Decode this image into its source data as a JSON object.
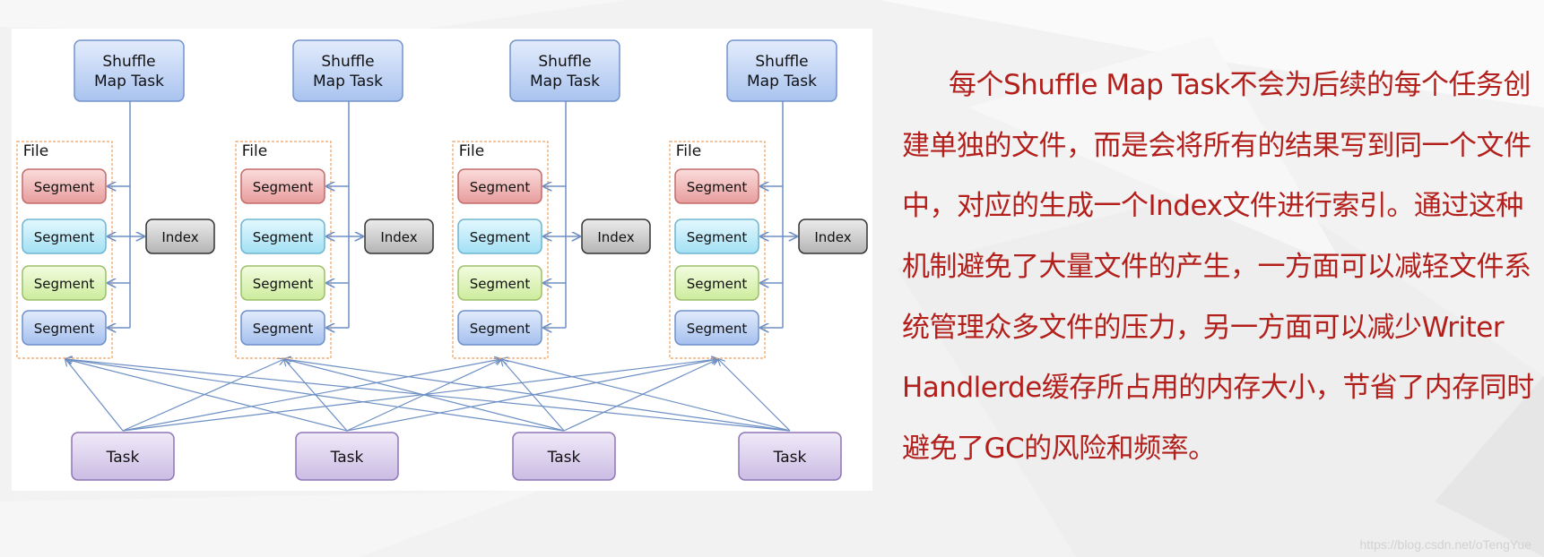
{
  "diagram": {
    "shuffle_task_label": [
      "Shuffle",
      "Map Task"
    ],
    "file_label": "File",
    "segment_label": "Segment",
    "index_label": "Index",
    "task_label": "Task",
    "columns": 4,
    "segment_colors": [
      "red",
      "cyan",
      "green",
      "blue"
    ],
    "colors": {
      "line": "#6d8fc4",
      "file_border": "#f0a060",
      "shuffle_fill": "#c3d6f6",
      "segment_red": "#f0b8b8",
      "segment_cyan": "#c2ecfa",
      "segment_green": "#e0f5bc",
      "segment_blue": "#c1d4f5",
      "index_fill": "#cfcfcf",
      "task_fill": "#ddd2ee"
    }
  },
  "text": {
    "color": "#b3201c",
    "lines": [
      "每个Shuffle Map Task不会为后续的每个任务创",
      "建单独的文件，而是会将所有的结果写到同一个文件",
      "中，对应的生成一个Index文件进行索引。通过这种",
      "机制避免了大量文件的产生，一方面可以减轻文件系",
      "统管理众多文件的压力，另一方面可以减少Writer",
      "Handlerde缓存所占用的内存大小，节省了内存同时",
      "避免了GC的风险和频率。"
    ]
  },
  "watermark": "https://blog.csdn.net/oTengYue"
}
